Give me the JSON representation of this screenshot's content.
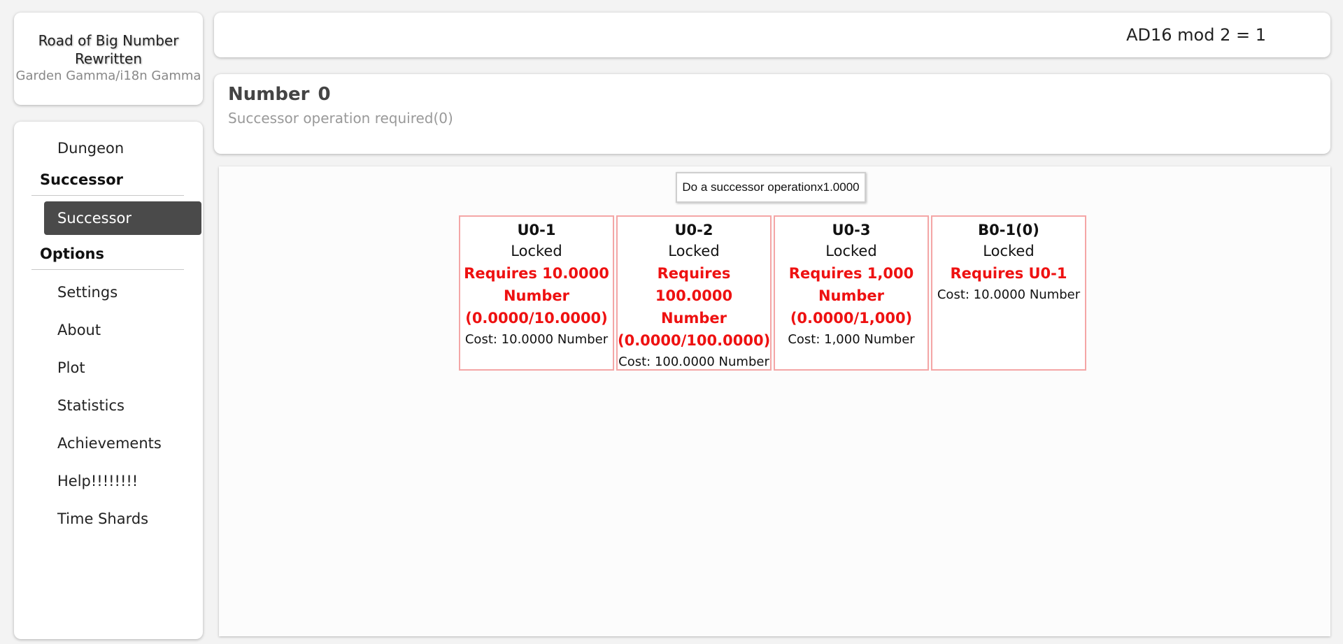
{
  "header": {
    "title": "Road of Big Number Rewritten",
    "version": "Garden Gamma/i18n Gamma",
    "ad_text": "AD16 mod 2 = 1"
  },
  "sidebar": {
    "items": [
      {
        "type": "item",
        "label": "Dungeon"
      },
      {
        "type": "heading",
        "label": "Successor"
      },
      {
        "type": "item",
        "label": "Successor",
        "active": true
      },
      {
        "type": "heading",
        "label": "Options"
      },
      {
        "type": "item",
        "label": "Settings"
      },
      {
        "type": "item",
        "label": "About"
      },
      {
        "type": "item",
        "label": "Plot"
      },
      {
        "type": "item",
        "label": "Statistics"
      },
      {
        "type": "item",
        "label": "Achievements"
      },
      {
        "type": "item",
        "label": "Help!!!!!!!!"
      },
      {
        "type": "item",
        "label": "Time Shards"
      }
    ]
  },
  "resource": {
    "label": "Number",
    "value": "0",
    "requirement": "Successor operation required(0)"
  },
  "main": {
    "action_button": "Do a successor operationx1.0000",
    "upgrades": [
      {
        "name": "U0-1",
        "status": "Locked",
        "req_line1": "Requires 10.0000",
        "req_line2": "Number",
        "req_line3": "(0.0000/10.0000)",
        "cost": "Cost: 10.0000 Number"
      },
      {
        "name": "U0-2",
        "status": "Locked",
        "req_line1": "Requires 100.0000",
        "req_line2": "Number",
        "req_line3": "(0.0000/100.0000)",
        "cost": "Cost: 100.0000 Number"
      },
      {
        "name": "U0-3",
        "status": "Locked",
        "req_line1": "Requires 1,000",
        "req_line2": "Number",
        "req_line3": "(0.0000/1,000)",
        "cost": "Cost: 1,000 Number"
      },
      {
        "name": "B0-1(0)",
        "status": "Locked",
        "req_line1": "Requires U0-1",
        "req_line2": "",
        "req_line3": "",
        "cost": "Cost: 10.0000 Number"
      }
    ]
  },
  "colors": {
    "background": "#f3f3f3",
    "active_nav": "#4a4a4a",
    "locked_requirement": "#ee1111",
    "locked_border": "#f4a6a6"
  }
}
